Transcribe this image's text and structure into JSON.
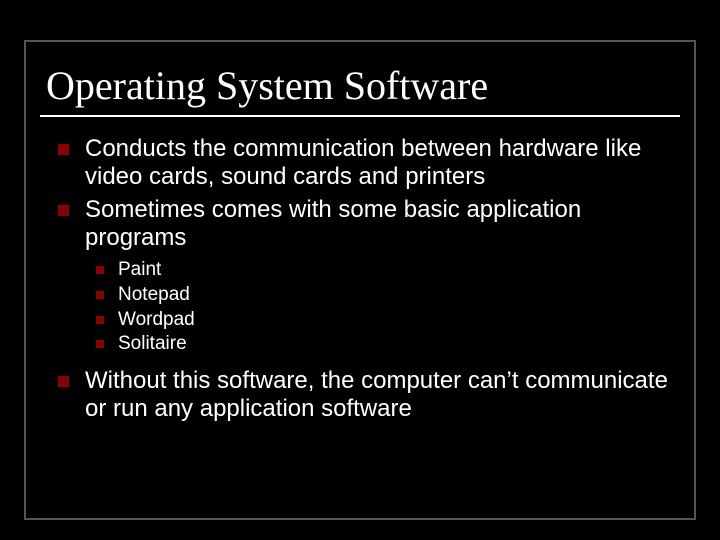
{
  "title": "Operating System Software",
  "bullets": {
    "b0": "Conducts the communication between hardware like video cards, sound cards and printers",
    "b1": "Sometimes comes with some basic application programs",
    "b2": "Without this software, the computer can’t communicate or run any application software"
  },
  "sub_bullets": {
    "s0": "Paint",
    "s1": "Notepad",
    "s2": "Wordpad",
    "s3": "Solitaire"
  }
}
